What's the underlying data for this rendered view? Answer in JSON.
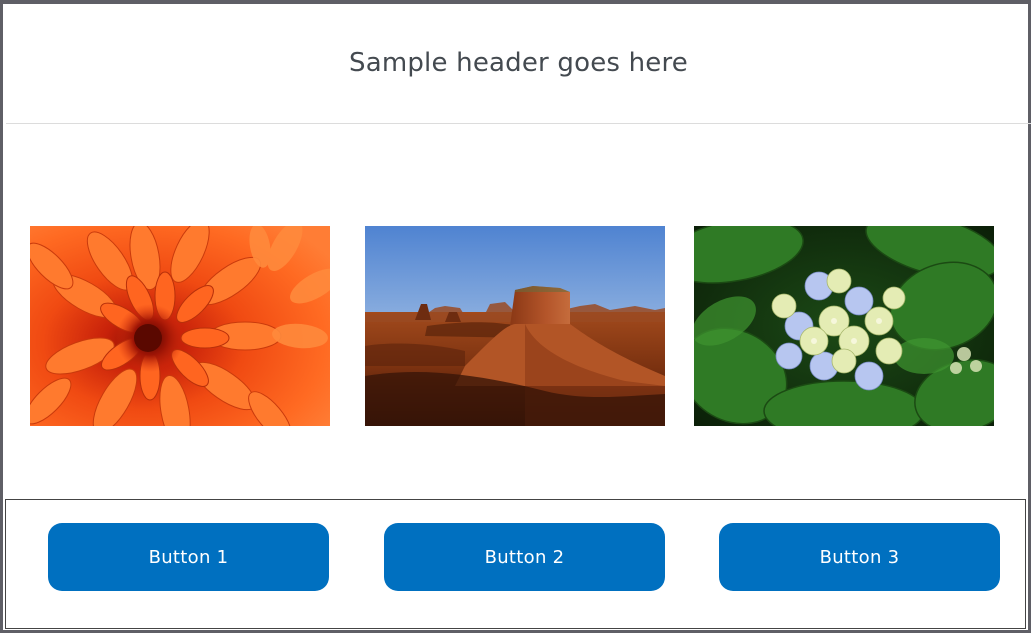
{
  "header": {
    "title": "Sample header goes here"
  },
  "gallery": {
    "images": [
      {
        "name": "orange-chrysanthemum-image"
      },
      {
        "name": "desert-mesa-image"
      },
      {
        "name": "hydrangea-flower-image"
      }
    ]
  },
  "footer": {
    "buttons": [
      {
        "label": "Button 1"
      },
      {
        "label": "Button 2"
      },
      {
        "label": "Button 3"
      }
    ]
  },
  "colors": {
    "button_bg": "#0070c0",
    "button_text": "#ffffff",
    "header_text": "#444a50",
    "frame_border": "#5f5f66"
  }
}
